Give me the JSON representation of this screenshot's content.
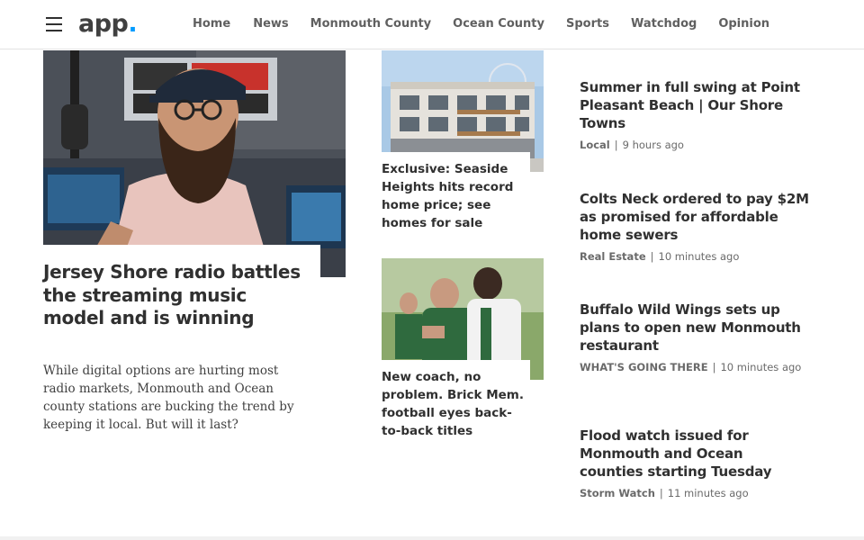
{
  "header": {
    "logo_text": "app",
    "logo_dot": ".",
    "menu_icon": "hamburger-menu-icon",
    "nav": [
      "Home",
      "News",
      "Monmouth County",
      "Ocean County",
      "Sports",
      "Watchdog",
      "Opinion"
    ]
  },
  "lead": {
    "title": "Jersey Shore radio battles the streaming music model and is winning",
    "summary": "While digital options are hurting most radio markets, Monmouth and Ocean county stations are bucking the trend by keeping it local. But will it last?"
  },
  "middle": [
    {
      "title": "Exclusive: Seaside Heights hits record home price; see homes for sale"
    },
    {
      "title": "New coach, no problem. Brick Mem. football eyes back-to-back titles"
    }
  ],
  "right": [
    {
      "title": "Summer in full swing at Point Pleasant Beach | Our Shore Towns",
      "tag": "Local",
      "sep": "|",
      "time": "9 hours ago"
    },
    {
      "title": "Colts Neck ordered to pay $2M as promised for affordable home sewers",
      "tag": "Real Estate",
      "sep": "|",
      "time": "10 minutes ago"
    },
    {
      "title": "Buffalo Wild Wings sets up plans to open new Monmouth restaurant",
      "tag": "WHAT'S GOING THERE",
      "sep": "|",
      "time": "10 minutes ago"
    },
    {
      "title": "Flood watch issued for Monmouth and Ocean counties starting Tuesday",
      "tag": "Storm Watch",
      "sep": "|",
      "time": "11 minutes ago"
    }
  ]
}
